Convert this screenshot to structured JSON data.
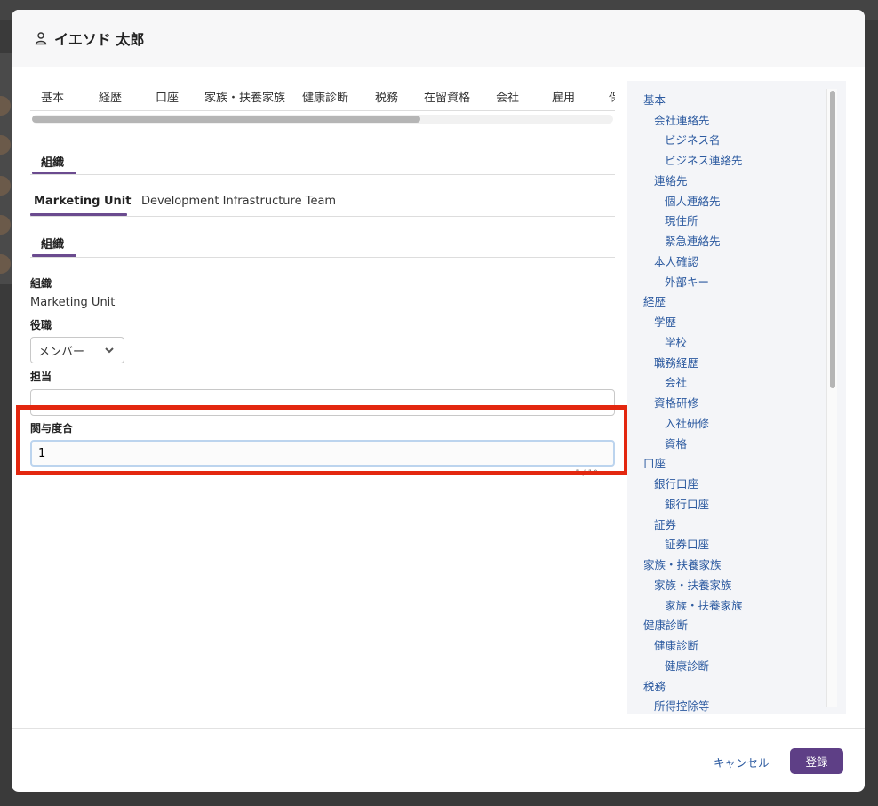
{
  "dialog": {
    "title": "イエソド 太郎"
  },
  "tabs": [
    "基本",
    "経歴",
    "口座",
    "家族・扶養家族",
    "健康診断",
    "税務",
    "在留資格",
    "会社",
    "雇用",
    "保"
  ],
  "section_tab": "組織",
  "org_tabs": [
    "Marketing Unit",
    "Development Infrastructure Team"
  ],
  "sub_section_tab": "組織",
  "form": {
    "org_label": "組織",
    "org_value": "Marketing Unit",
    "role_label": "役職",
    "role_value": "メンバー",
    "assignee_label": "担当",
    "assignee_value": "",
    "involvement_label": "関与度合",
    "involvement_value": "1",
    "involvement_counter": "1 / 19"
  },
  "toc": [
    "基本",
    "会社連絡先",
    "ビジネス名",
    "ビジネス連絡先",
    "連絡先",
    "個人連絡先",
    "現住所",
    "緊急連絡先",
    "本人確認",
    "外部キー",
    "経歴",
    "学歴",
    "学校",
    "職務経歴",
    "会社",
    "資格研修",
    "入社研修",
    "資格",
    "口座",
    "銀行口座",
    "銀行口座",
    "証券",
    "証券口座",
    "家族・扶養家族",
    "家族・扶養家族",
    "家族・扶養家族",
    "健康診断",
    "健康診断",
    "健康診断",
    "税務",
    "所得控除等"
  ],
  "footer": {
    "cancel": "キャンセル",
    "submit": "登録"
  },
  "colors": {
    "accent": "#5e3f86",
    "link": "#2c5aa0",
    "highlight": "#e3270f"
  }
}
